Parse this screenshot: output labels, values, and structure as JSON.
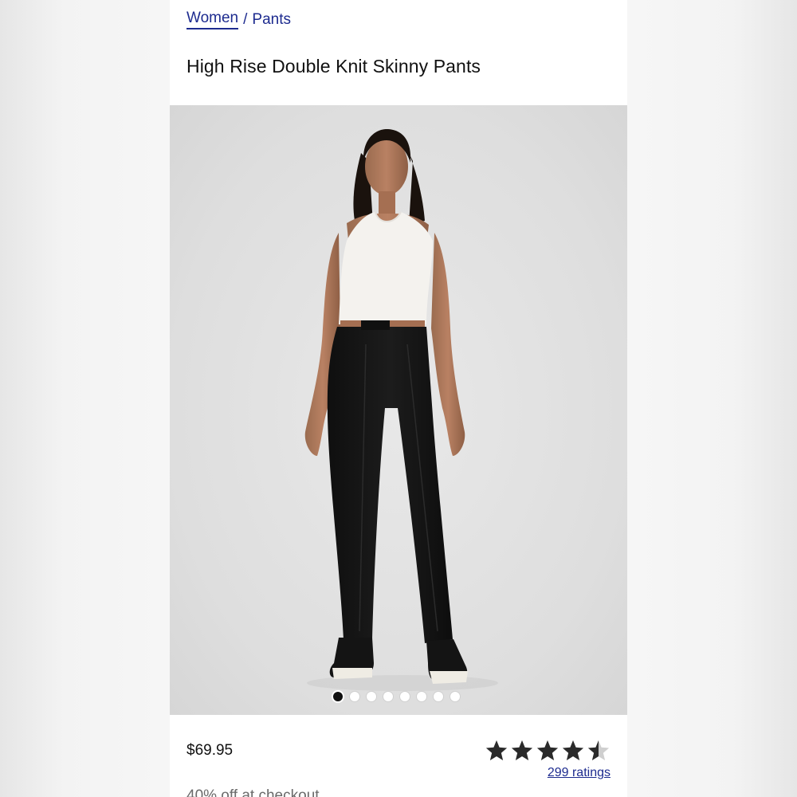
{
  "breadcrumb": {
    "items": [
      {
        "label": "Women"
      },
      {
        "label": "Pants"
      }
    ],
    "separator": "/"
  },
  "product": {
    "title": "High Rise Double Knit Skinny Pants",
    "price": "$69.95",
    "promo": "40% off at checkout",
    "rating": {
      "value": 4.5,
      "max": 5,
      "count_label": "299 ratings"
    }
  },
  "gallery": {
    "image_count": 8,
    "active_index": 0,
    "background": "#dedede"
  },
  "colors": {
    "link": "#1d2b8f",
    "text": "#111111",
    "star": "#2a2a2a",
    "star_empty": "#cfcfcf"
  },
  "icons": {
    "rating_star": "star-icon"
  }
}
